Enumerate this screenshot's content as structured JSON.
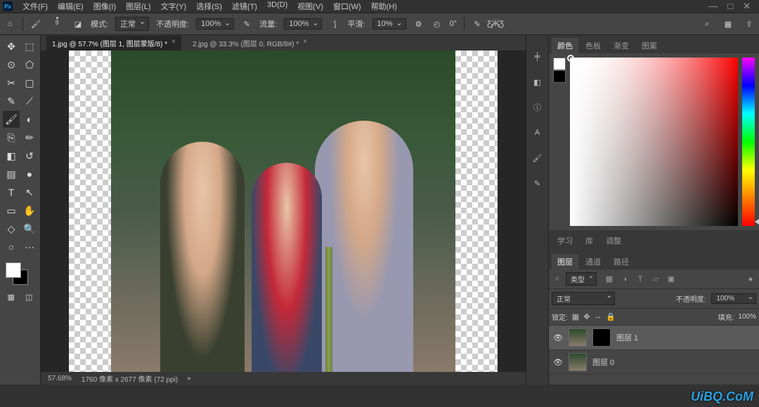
{
  "app": {
    "logo": "Ps"
  },
  "menu": {
    "file": "文件(F)",
    "edit": "编辑(E)",
    "image": "图像(I)",
    "layer": "图层(L)",
    "type": "文字(Y)",
    "select": "选择(S)",
    "filter": "滤镜(T)",
    "view3d": "3D(D)",
    "view": "视图(V)",
    "window": "窗口(W)",
    "help": "帮助(H)"
  },
  "window_ctrl": {
    "min": "—",
    "max": "□",
    "close": "✕"
  },
  "options": {
    "home_icon": "home-icon",
    "brush_icon": "brush-icon",
    "brush_size": "9",
    "swap_icon": "swap-icon",
    "mode_label": "模式:",
    "mode_value": "正常",
    "opacity_label": "不透明度:",
    "opacity_value": "100%",
    "opacity_icon": "opacity-dyn-icon",
    "flow_label": "流量:",
    "flow_value": "100%",
    "flow_icon": "flow-dyn-icon",
    "smooth_label": "平滑:",
    "smooth_value": "10%",
    "gear_icon": "gear-icon",
    "angle_icon": "angle-icon",
    "angle_value": "0°",
    "airbrush_icon": "airbrush-icon",
    "butterfly_icon": "symmetry-icon",
    "search_icon": "search-icon",
    "grid_icon": "grid-icon",
    "share_icon": "share-icon"
  },
  "tools": [
    "move",
    "marquee",
    "lasso",
    "polygon-lasso",
    "crop",
    "frame",
    "eyedropper",
    "ruler",
    "brush",
    "spot-heal",
    "clone",
    "pencil",
    "eraser",
    "history-brush",
    "gradient",
    "blur",
    "type",
    "path-select",
    "rectangle",
    "hand",
    "custom-shape",
    "zoom",
    "ellipse",
    "more"
  ],
  "tool_glyphs": [
    "✥",
    "⬚",
    "⊙",
    "⬠",
    "✂",
    "▢",
    "✎",
    "⟋",
    "🖌",
    "◐",
    "⎘",
    "✏",
    "◧",
    "↺",
    "▤",
    "●",
    "T",
    "↖",
    "▭",
    "✋",
    "◇",
    "🔍",
    "○",
    "⋯"
  ],
  "active_tool_index": 8,
  "swatch": {
    "fg": "#ffffff",
    "bg": "#000000"
  },
  "quickmask": {
    "a": "▦",
    "b": "◫"
  },
  "docs": {
    "tab1": {
      "label": "1.jpg @ 57.7% (图层 1, 图层蒙版/8) *",
      "close": "×"
    },
    "tab2": {
      "label": "2.jpg @ 33.3% (图层 0, RGB/8#) *",
      "close": "×"
    }
  },
  "status": {
    "zoom": "57.68%",
    "doc": "1760 像素 x 2677 像素 (72 ppi)",
    "tri": "▸"
  },
  "dock": [
    "history",
    "adjust",
    "properties",
    "char",
    "brush-panel",
    "brush-preset"
  ],
  "dock_glyphs": [
    "╪",
    "◧",
    "ⓘ",
    "A",
    "🖌",
    "✎"
  ],
  "color_panel": {
    "tabs": {
      "color": "颜色",
      "swatches": "色板",
      "gradients": "渐变",
      "patterns": "图案"
    },
    "fg": "#ffffff",
    "bg": "#000000"
  },
  "midpanel": {
    "tabs": {
      "learn": "学习",
      "lib": "库",
      "adjust": "调整"
    }
  },
  "layers": {
    "tabs": {
      "layers": "图层",
      "channels": "通道",
      "paths": "路径"
    },
    "filter": {
      "search": "⌕",
      "kind_label": "类型",
      "icons": [
        "image",
        "adj",
        "type",
        "shape",
        "smart"
      ],
      "glyphs": [
        "▦",
        "◑",
        "T",
        "▱",
        "▣"
      ],
      "toggle": "●"
    },
    "blend": {
      "mode": "正常",
      "opacity_label": "不透明度:",
      "opacity": "100%"
    },
    "lock": {
      "label": "锁定:",
      "icons": [
        "pixels",
        "position",
        "artboard",
        "all"
      ],
      "glyphs": [
        "▦",
        "✥",
        "↔",
        "🔒"
      ],
      "fill_label": "填充:",
      "fill": "100%"
    },
    "rows": [
      {
        "visible": "👁",
        "name": "图层 1",
        "has_mask": true
      },
      {
        "visible": "👁",
        "name": "图层 0",
        "has_mask": false
      }
    ]
  },
  "watermark": "UiBQ.CoM"
}
